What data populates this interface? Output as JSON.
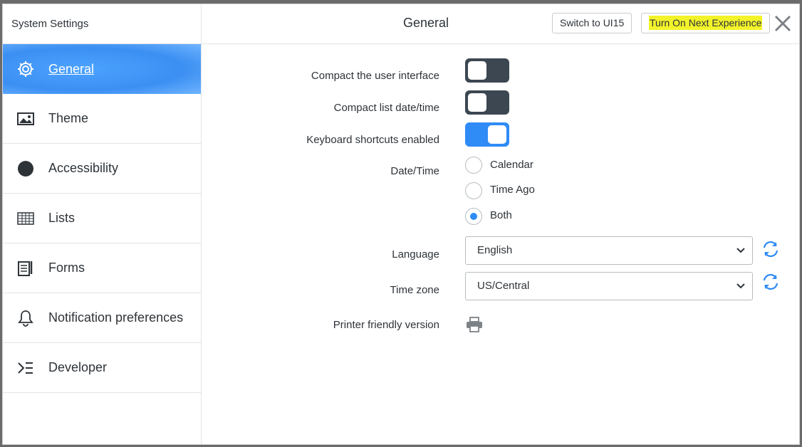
{
  "sidebar": {
    "title": "System Settings",
    "items": [
      {
        "label": "General",
        "icon": "gear-icon",
        "active": true
      },
      {
        "label": "Theme",
        "icon": "image-icon"
      },
      {
        "label": "Accessibility",
        "icon": "circle-icon"
      },
      {
        "label": "Lists",
        "icon": "list-grid-icon"
      },
      {
        "label": "Forms",
        "icon": "form-icon"
      },
      {
        "label": "Notification preferences",
        "icon": "bell-icon"
      },
      {
        "label": "Developer",
        "icon": "developer-icon"
      }
    ]
  },
  "header": {
    "title": "General",
    "switch_button": "Switch to UI15",
    "next_button": "Turn On Next Experience",
    "close_icon": "close-icon"
  },
  "settings": {
    "compact_ui": {
      "label": "Compact the user interface",
      "state": "off"
    },
    "compact_list": {
      "label": "Compact list date/time",
      "state": "off"
    },
    "keyboard": {
      "label": "Keyboard shortcuts enabled",
      "state": "on"
    },
    "datetime": {
      "label": "Date/Time",
      "options": [
        "Calendar",
        "Time Ago",
        "Both"
      ],
      "selected": "Both"
    },
    "language": {
      "label": "Language",
      "value": "English"
    },
    "timezone": {
      "label": "Time zone",
      "value": "US/Central"
    },
    "printer": {
      "label": "Printer friendly version",
      "icon": "printer-icon"
    }
  },
  "colors": {
    "accent": "#2f8cf6",
    "toggle_off": "#3d4752",
    "highlight": "#f3f32a"
  }
}
